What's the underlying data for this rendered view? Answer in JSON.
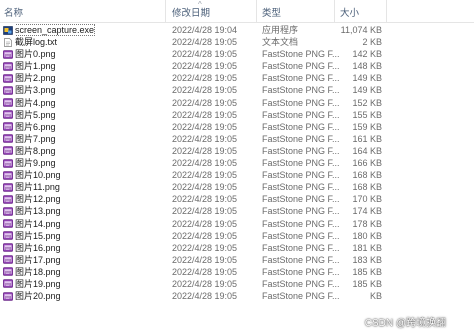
{
  "columns": {
    "name": "名称",
    "date": "修改日期",
    "type": "类型",
    "size": "大小"
  },
  "files": [
    {
      "name": "screen_capture.exe",
      "date": "2022/4/28 19:04",
      "type": "应用程序",
      "size": "11,074 KB",
      "icon": "exe-icon"
    },
    {
      "name": "截屏log.txt",
      "date": "2022/4/28 19:05",
      "type": "文本文档",
      "size": "2 KB",
      "icon": "text-file-icon"
    },
    {
      "name": "图片0.png",
      "date": "2022/4/28 19:05",
      "type": "FastStone PNG F...",
      "size": "142 KB",
      "icon": "png-icon"
    },
    {
      "name": "图片1.png",
      "date": "2022/4/28 19:05",
      "type": "FastStone PNG F...",
      "size": "148 KB",
      "icon": "png-icon"
    },
    {
      "name": "图片2.png",
      "date": "2022/4/28 19:05",
      "type": "FastStone PNG F...",
      "size": "149 KB",
      "icon": "png-icon"
    },
    {
      "name": "图片3.png",
      "date": "2022/4/28 19:05",
      "type": "FastStone PNG F...",
      "size": "149 KB",
      "icon": "png-icon"
    },
    {
      "name": "图片4.png",
      "date": "2022/4/28 19:05",
      "type": "FastStone PNG F...",
      "size": "152 KB",
      "icon": "png-icon"
    },
    {
      "name": "图片5.png",
      "date": "2022/4/28 19:05",
      "type": "FastStone PNG F...",
      "size": "155 KB",
      "icon": "png-icon"
    },
    {
      "name": "图片6.png",
      "date": "2022/4/28 19:05",
      "type": "FastStone PNG F...",
      "size": "159 KB",
      "icon": "png-icon"
    },
    {
      "name": "图片7.png",
      "date": "2022/4/28 19:05",
      "type": "FastStone PNG F...",
      "size": "161 KB",
      "icon": "png-icon"
    },
    {
      "name": "图片8.png",
      "date": "2022/4/28 19:05",
      "type": "FastStone PNG F...",
      "size": "164 KB",
      "icon": "png-icon"
    },
    {
      "name": "图片9.png",
      "date": "2022/4/28 19:05",
      "type": "FastStone PNG F...",
      "size": "166 KB",
      "icon": "png-icon"
    },
    {
      "name": "图片10.png",
      "date": "2022/4/28 19:05",
      "type": "FastStone PNG F...",
      "size": "168 KB",
      "icon": "png-icon"
    },
    {
      "name": "图片11.png",
      "date": "2022/4/28 19:05",
      "type": "FastStone PNG F...",
      "size": "168 KB",
      "icon": "png-icon"
    },
    {
      "name": "图片12.png",
      "date": "2022/4/28 19:05",
      "type": "FastStone PNG F...",
      "size": "170 KB",
      "icon": "png-icon"
    },
    {
      "name": "图片13.png",
      "date": "2022/4/28 19:05",
      "type": "FastStone PNG F...",
      "size": "174 KB",
      "icon": "png-icon"
    },
    {
      "name": "图片14.png",
      "date": "2022/4/28 19:05",
      "type": "FastStone PNG F...",
      "size": "178 KB",
      "icon": "png-icon"
    },
    {
      "name": "图片15.png",
      "date": "2022/4/28 19:05",
      "type": "FastStone PNG F...",
      "size": "180 KB",
      "icon": "png-icon"
    },
    {
      "name": "图片16.png",
      "date": "2022/4/28 19:05",
      "type": "FastStone PNG F...",
      "size": "181 KB",
      "icon": "png-icon"
    },
    {
      "name": "图片17.png",
      "date": "2022/4/28 19:05",
      "type": "FastStone PNG F...",
      "size": "183 KB",
      "icon": "png-icon"
    },
    {
      "name": "图片18.png",
      "date": "2022/4/28 19:05",
      "type": "FastStone PNG F...",
      "size": "185 KB",
      "icon": "png-icon"
    },
    {
      "name": "图片19.png",
      "date": "2022/4/28 19:05",
      "type": "FastStone PNG F...",
      "size": "185 KB",
      "icon": "png-icon"
    },
    {
      "name": "图片20.png",
      "date": "2022/4/28 19:05",
      "type": "FastStone PNG F...",
      "size": "KB",
      "icon": "png-icon"
    }
  ],
  "watermark": "CSDN @跨境换翻",
  "colors": {
    "header_text": "#4c607a",
    "row_text": "#1b1b1b",
    "meta_text": "#6b6b6b",
    "png_icon": "#9b3fb8"
  }
}
